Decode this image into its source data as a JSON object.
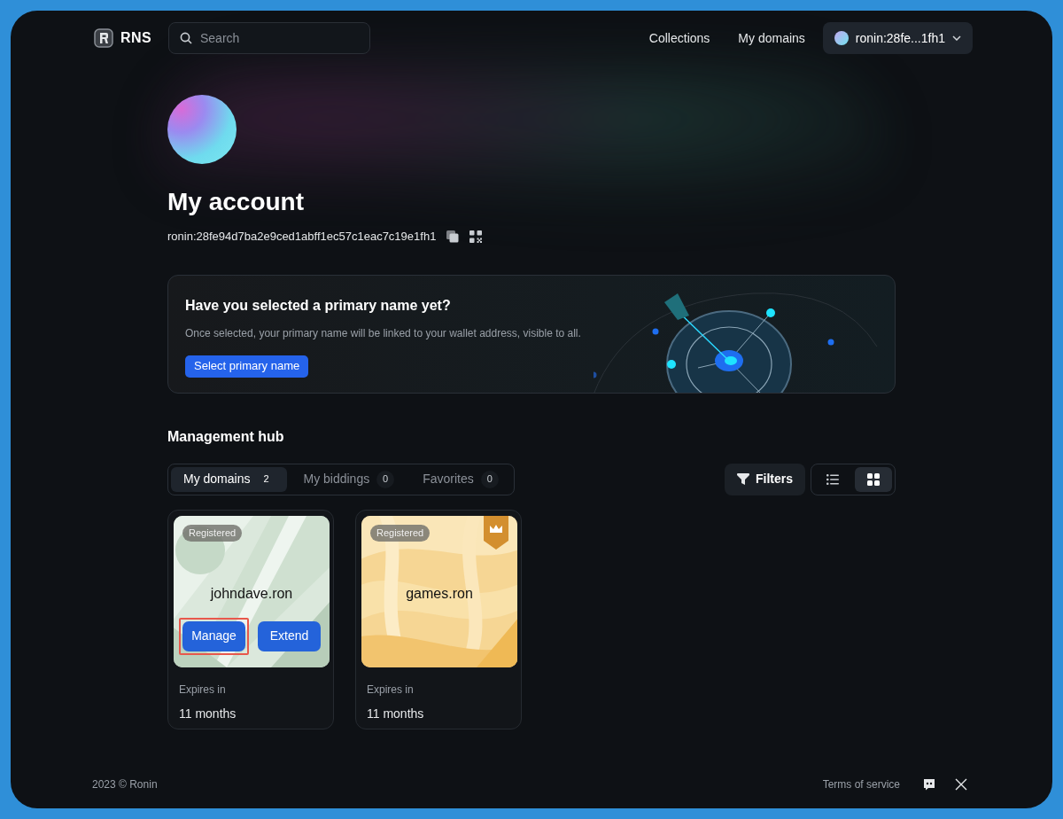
{
  "header": {
    "logo": "RNS",
    "search": {
      "placeholder": "Search"
    },
    "nav": [
      "Collections",
      "My domains"
    ],
    "account": "ronin:28fe...1fh1"
  },
  "profile": {
    "title": "My account",
    "address": "ronin:28fe94d7ba2e9ced1abff1ec57c1eac7c19e1fh1"
  },
  "banner": {
    "title": "Have you selected a primary name yet?",
    "text": "Once selected, your primary name will be linked to your wallet address, visible to all.",
    "button": "Select primary name"
  },
  "hub": {
    "title": "Management hub",
    "tabs": [
      {
        "label": "My domains",
        "count": "2",
        "selected": true
      },
      {
        "label": "My biddings",
        "count": "0",
        "selected": false
      },
      {
        "label": "Favorites",
        "count": "0",
        "selected": false
      }
    ],
    "filters": "Filters",
    "views": [
      {
        "kind": "list",
        "selected": false
      },
      {
        "kind": "grid",
        "selected": true
      }
    ],
    "domains": [
      {
        "name": "johndave.ron",
        "status": "Registered",
        "kind": "green",
        "premium": false,
        "expires_label": "Expires in",
        "expires": "11 months",
        "actions": [
          {
            "label": "Manage",
            "highlighted": true
          },
          {
            "label": "Extend",
            "highlighted": false
          }
        ]
      },
      {
        "name": "games.ron",
        "status": "Registered",
        "kind": "gold",
        "premium": true,
        "expires_label": "Expires in",
        "expires": "11 months"
      }
    ]
  },
  "footer": {
    "copyright": "2023 © Ronin",
    "links": [
      "Terms of service"
    ]
  }
}
